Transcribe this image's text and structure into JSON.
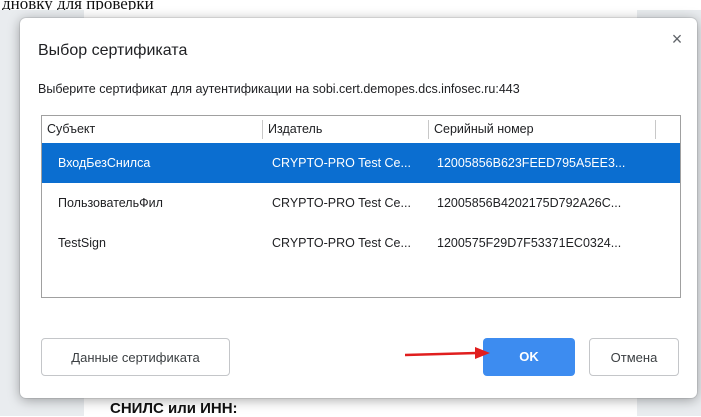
{
  "background": {
    "top_text": "дновку для проверки",
    "bottom_text": "СНИЛС или ИНН:"
  },
  "dialog": {
    "title": "Выбор сертификата",
    "description": "Выберите сертификат для аутентификации на sobi.cert.demopes.dcs.infosec.ru:443",
    "close_icon": "×",
    "table": {
      "headers": [
        "Субъект",
        "Издатель",
        "Серийный номер"
      ],
      "rows": [
        {
          "subject": "ВходБезСнилса",
          "issuer": "CRYPTO-PRO Test Ce...",
          "serial": "12005856B623FEED795A5EE3...",
          "selected": true
        },
        {
          "subject": "ПользовательФил",
          "issuer": "CRYPTO-PRO Test Ce...",
          "serial": "12005856B4202175D792A26C...",
          "selected": false
        },
        {
          "subject": "TestSign",
          "issuer": "CRYPTO-PRO Test Ce...",
          "serial": "1200575F29D7F53371EC0324...",
          "selected": false
        }
      ]
    },
    "buttons": {
      "details": "Данные сертификата",
      "ok": "OK",
      "cancel": "Отмена"
    }
  },
  "colors": {
    "selection": "#0b6ed0",
    "ok_button": "#3d8cf0",
    "arrow": "#e01e1e"
  }
}
